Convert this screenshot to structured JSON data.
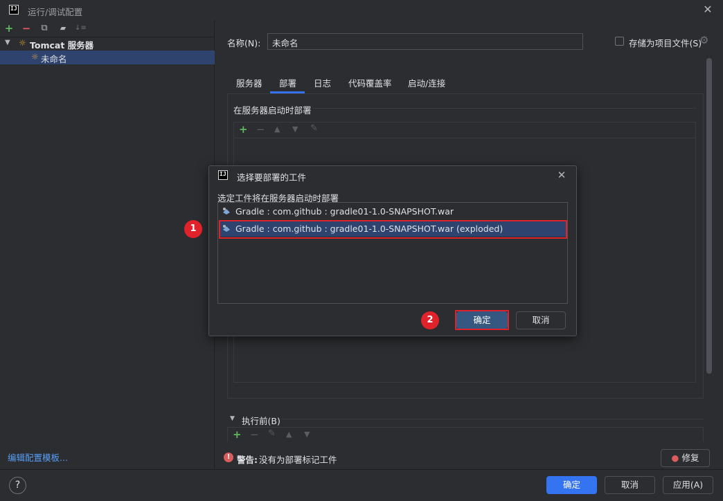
{
  "window": {
    "title": "运行/调试配置",
    "logo_text": "IJ"
  },
  "left_toolbar": {
    "add": "+",
    "remove": "−",
    "copy": "⧉",
    "folder": "▰",
    "sort": "↓≡"
  },
  "tree": {
    "group_label": "Tomcat 服务器",
    "item_label": "未命名"
  },
  "edit_templates_link": "编辑配置模板...",
  "form": {
    "name_label": "名称(N):",
    "name_value": "未命名",
    "store_as_project_label": "存储为项目文件(S)"
  },
  "tabs": [
    "服务器",
    "部署",
    "日志",
    "代码覆盖率",
    "启动/连接"
  ],
  "active_tab_index": 1,
  "deploy_section_title": "在服务器启动时部署",
  "before_launch_label": "执行前(B)",
  "warning": {
    "prefix": "警告:",
    "text": "没有为部署标记工件",
    "fix_label": "修复"
  },
  "bottom_buttons": {
    "ok": "确定",
    "cancel": "取消",
    "apply": "应用(A)",
    "help": "?"
  },
  "dialog": {
    "title": "选择要部署的工件",
    "subtitle": "选定工件将在服务器启动时部署",
    "artifacts": [
      "Gradle : com.github : gradle01-1.0-SNAPSHOT.war",
      "Gradle : com.github : gradle01-1.0-SNAPSHOT.war (exploded)"
    ],
    "selected_index": 1,
    "ok_label": "确定",
    "cancel_label": "取消"
  },
  "annotations": {
    "badge1": "1",
    "badge2": "2"
  },
  "colors": {
    "accent": "#3574f0",
    "selection": "#2e436e",
    "annotation_red": "#e0232b",
    "add_green": "#5fb85f"
  }
}
